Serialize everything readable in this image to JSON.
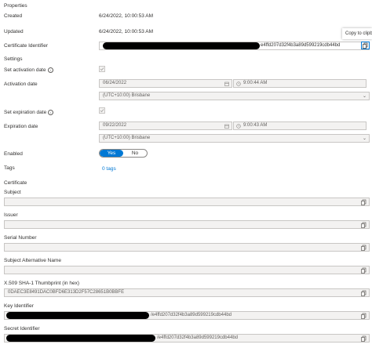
{
  "properties": {
    "heading": "Properties",
    "created_label": "Created",
    "created_value": "6/24/2022, 10:00:53 AM",
    "updated_label": "Updated",
    "updated_value": "6/24/2022, 10:00:53 AM",
    "cert_id_label": "Certificate Identifier",
    "cert_id_value": "e4ffd207d32f4b3a89d599219cdb44bd",
    "copy_tooltip": "Copy to clipboard"
  },
  "settings": {
    "heading": "Settings",
    "set_activation_label": "Set activation date",
    "activation_date_label": "Activation date",
    "activation_date_value": "06/24/2022",
    "activation_time_value": "9:00:44 AM",
    "activation_tz_value": "(UTC+10:00) Brisbane",
    "set_expiration_label": "Set expiration date",
    "expiration_date_label": "Expiration date",
    "expiration_date_value": "09/22/2022",
    "expiration_time_value": "9:00:43 AM",
    "expiration_tz_value": "(UTC+10:00) Brisbane",
    "enabled_label": "Enabled",
    "toggle_yes": "Yes",
    "toggle_no": "No",
    "tags_label": "Tags",
    "tags_value": "0 tags"
  },
  "certificate": {
    "heading": "Certificate",
    "subject_label": "Subject",
    "issuer_label": "Issuer",
    "serial_label": "Serial Number",
    "san_label": "Subject Alternative Name",
    "thumbprint_label": "X.509 SHA-1 Thumbprint (in hex)",
    "thumbprint_value": "0DAEC3E8491DAC0BFD6E313D2F57C28651B0BBFE",
    "key_id_label": "Key Identifier",
    "key_id_value": "/e4ffd207d32f4b3a89d599219cdb44bd",
    "secret_id_label": "Secret Identifier",
    "secret_id_value": "/e4ffd207d32f4b3a89d599219cdb44bd"
  },
  "icons": [
    "copy-icon",
    "calendar-icon",
    "clock-icon",
    "chevron-down-icon",
    "info-icon",
    "checkmark-icon"
  ],
  "colors": {
    "accent": "#0078d4",
    "disabled_bg": "#f3f2f1",
    "border": "#c8c6c4"
  }
}
